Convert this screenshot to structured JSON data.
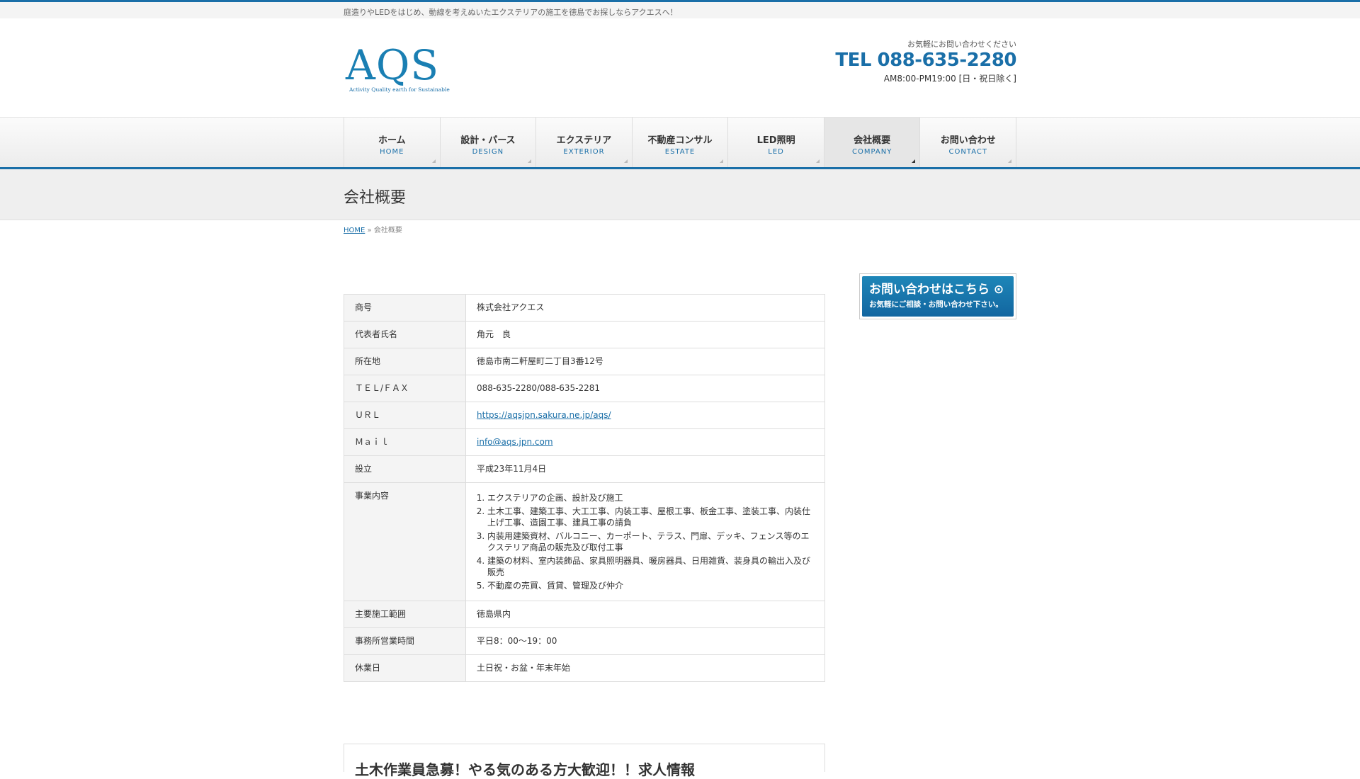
{
  "topbar": {
    "description": "庭造りやLEDをはじめ、動線を考えぬいたエクステリアの施工を徳島でお探しならアクエスへ！"
  },
  "header": {
    "logo_mark": "AQS",
    "logo_tagline": "Activity Quality earth for Sustainable",
    "contact_lead": "お気軽にお問い合わせください",
    "tel": "TEL 088-635-2280",
    "hours": "AM8:00-PM19:00 [日・祝日除く]"
  },
  "nav": {
    "items": [
      {
        "jp": "ホーム",
        "en": "HOME"
      },
      {
        "jp": "設計・パース",
        "en": "DESIGN"
      },
      {
        "jp": "エクステリア",
        "en": "EXTERIOR"
      },
      {
        "jp": "不動産コンサル",
        "en": "ESTATE"
      },
      {
        "jp": "LED照明",
        "en": "LED"
      },
      {
        "jp": "会社概要",
        "en": "COMPANY"
      },
      {
        "jp": "お問い合わせ",
        "en": "CONTACT"
      }
    ],
    "active_index": 5
  },
  "page": {
    "title": "会社概要"
  },
  "breadcrumb": {
    "home": "HOME",
    "separator": "»",
    "current": "会社概要"
  },
  "company_table": {
    "rows": [
      {
        "label": "商号",
        "value": "株式会社アクエス"
      },
      {
        "label": "代表者氏名",
        "value": "角元　良"
      },
      {
        "label": "所在地",
        "value": "徳島市南二軒屋町二丁目3番12号"
      },
      {
        "label": "ＴＥＬ/ＦＡＸ",
        "value": "088-635-2280/088-635-2281"
      },
      {
        "label": "ＵＲＬ",
        "value": "https://aqsjpn.sakura.ne.jp/aqs/"
      },
      {
        "label": "Ｍａｉｌ",
        "value": "info@aqs.jpn.com"
      },
      {
        "label": "設立",
        "value": "平成23年11月4日"
      },
      {
        "label": "事業内容",
        "list": [
          "エクステリアの企画、設計及び施工",
          "土木工事、建築工事、大工工事、内装工事、屋根工事、板金工事、塗装工事、内装仕上げ工事、造園工事、建具工事の請負",
          "内装用建築資材、バルコニー、カーポート、テラス、門扉、デッキ、フェンス等のエクステリア商品の販売及び取付工事",
          "建築の材料、室内装飾品、家具照明器具、暖房器具、日用雑貨、装身具の輸出入及び販売",
          "不動産の売買、賃貸、管理及び仲介"
        ]
      },
      {
        "label": "主要施工範囲",
        "value": "徳島県内"
      },
      {
        "label": "事務所営業時間",
        "value": "平日8：00～19：00"
      },
      {
        "label": "休業日",
        "value": "土日祝・お盆・年末年始"
      }
    ]
  },
  "sidebar": {
    "banner_title": "お問い合わせはこちら ⊙",
    "banner_sub": "お気軽にご相談・お問い合わせ下さい。"
  },
  "bottom": {
    "heading": "土木作業員急募！やる気のある方大歓迎！！求人情報"
  },
  "colors": {
    "accent": "#1a6fa8",
    "logo": "#1a7fb3"
  }
}
